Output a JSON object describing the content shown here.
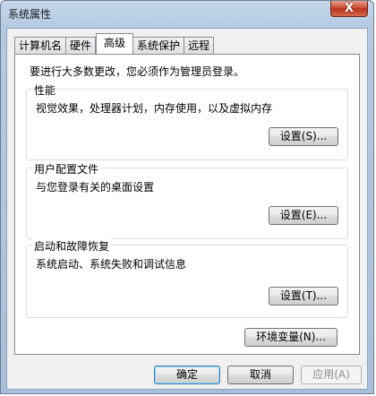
{
  "window": {
    "title": "系统属性",
    "close_glyph": "X"
  },
  "tabs": [
    {
      "label": "计算机名",
      "active": false
    },
    {
      "label": "硬件",
      "active": false
    },
    {
      "label": "高级",
      "active": true
    },
    {
      "label": "系统保护",
      "active": false
    },
    {
      "label": "远程",
      "active": false
    }
  ],
  "advanced": {
    "admin_note": "要进行大多数更改，您必须作为管理员登录。",
    "performance": {
      "title": "性能",
      "description": "视觉效果，处理器计划，内存使用，以及虚拟内存",
      "button": "设置(S)..."
    },
    "user_profiles": {
      "title": "用户配置文件",
      "description": "与您登录有关的桌面设置",
      "button": "设置(E)..."
    },
    "startup_recovery": {
      "title": "启动和故障恢复",
      "description": "系统启动、系统失败和调试信息",
      "button": "设置(T)..."
    },
    "env_button": "环境变量(N)..."
  },
  "footer": {
    "ok": "确定",
    "cancel": "取消",
    "apply": "应用(A)"
  }
}
